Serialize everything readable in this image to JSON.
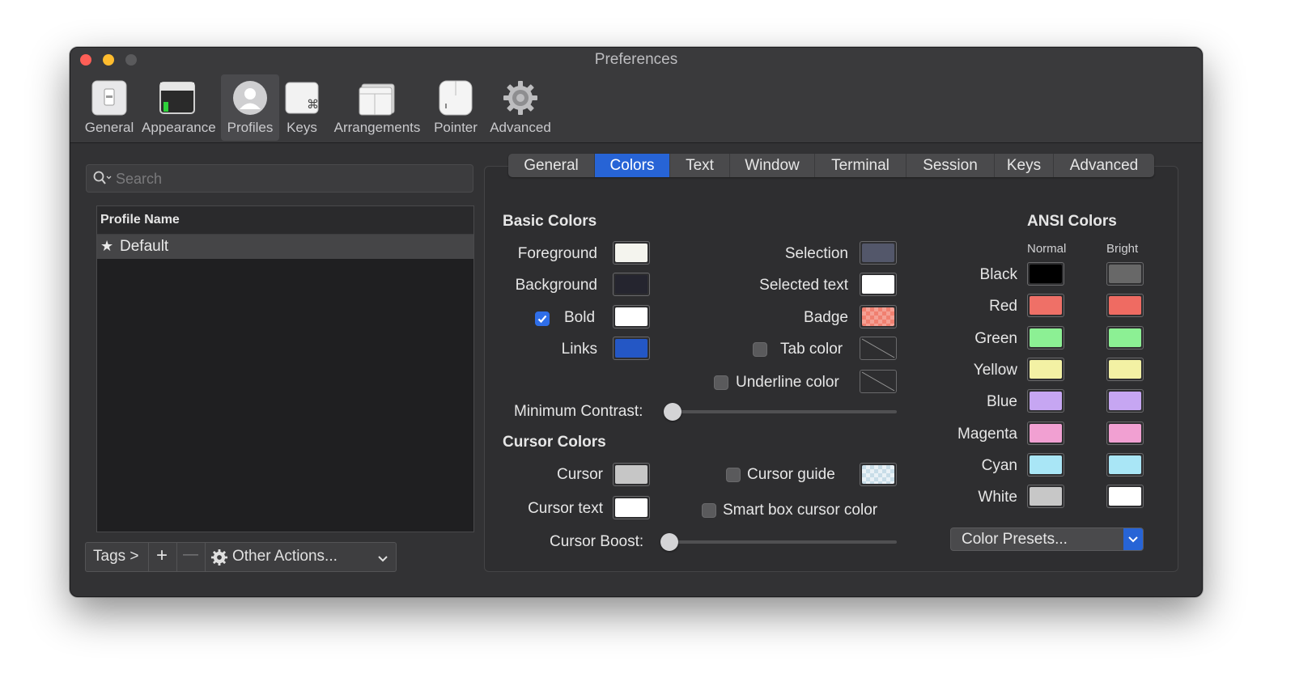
{
  "window": {
    "title": "Preferences"
  },
  "toolbar": {
    "items": [
      {
        "label": "General",
        "icon": "switch-icon"
      },
      {
        "label": "Appearance",
        "icon": "appearance-icon"
      },
      {
        "label": "Profiles",
        "icon": "profile-icon",
        "active": true
      },
      {
        "label": "Keys",
        "icon": "command-key-icon"
      },
      {
        "label": "Arrangements",
        "icon": "arrangements-icon"
      },
      {
        "label": "Pointer",
        "icon": "mouse-icon"
      },
      {
        "label": "Advanced",
        "icon": "gear-icon"
      }
    ]
  },
  "sidebar": {
    "search_placeholder": "Search",
    "profile_list": {
      "header": "Profile Name",
      "rows": [
        {
          "name": "Default",
          "default_star": "★"
        }
      ]
    },
    "bottom": {
      "tags_label": "Tags >",
      "add_label": "+",
      "remove_label": "—",
      "other_actions_label": "Other Actions..."
    }
  },
  "tabs": [
    "General",
    "Colors",
    "Text",
    "Window",
    "Terminal",
    "Session",
    "Keys",
    "Advanced"
  ],
  "active_tab": "Colors",
  "basic_colors": {
    "title": "Basic Colors",
    "foreground": {
      "label": "Foreground",
      "color": "#f4f4ee"
    },
    "background": {
      "label": "Background",
      "color": "#25252f"
    },
    "bold": {
      "label": "Bold",
      "checked": true,
      "color": "#ffffff"
    },
    "links": {
      "label": "Links",
      "color": "#2457c5"
    },
    "selection": {
      "label": "Selection",
      "color": "#53576a"
    },
    "selected_text": {
      "label": "Selected text",
      "color": "#ffffff"
    },
    "badge": {
      "label": "Badge",
      "color": "#f08070"
    },
    "tab_color": {
      "label": "Tab color",
      "checked": false
    },
    "underline_color": {
      "label": "Underline color",
      "checked": false
    },
    "minimum_contrast": {
      "label": "Minimum Contrast:",
      "value": 0
    }
  },
  "cursor_colors": {
    "title": "Cursor Colors",
    "cursor": {
      "label": "Cursor",
      "color": "#c6c6c6"
    },
    "cursor_text": {
      "label": "Cursor text",
      "color": "#ffffff"
    },
    "cursor_guide": {
      "label": "Cursor guide",
      "checked": false,
      "color": "#c8dde8"
    },
    "smart_box": {
      "label": "Smart box cursor color",
      "checked": false
    },
    "cursor_boost": {
      "label": "Cursor Boost:",
      "value": 0
    }
  },
  "ansi": {
    "title": "ANSI Colors",
    "normal_label": "Normal",
    "bright_label": "Bright",
    "rows": [
      {
        "name": "Black",
        "normal": "#000000",
        "bright": "#686868"
      },
      {
        "name": "Red",
        "normal": "#ef7067",
        "bright": "#ef6b62"
      },
      {
        "name": "Green",
        "normal": "#8cf094",
        "bright": "#8cf094"
      },
      {
        "name": "Yellow",
        "normal": "#f3f1a4",
        "bright": "#f3f1a4"
      },
      {
        "name": "Blue",
        "normal": "#c6a6f2",
        "bright": "#c6a6f2"
      },
      {
        "name": "Magenta",
        "normal": "#f1a0d2",
        "bright": "#f1a0d2"
      },
      {
        "name": "Cyan",
        "normal": "#a9e6f6",
        "bright": "#a9e6f6"
      },
      {
        "name": "White",
        "normal": "#c7c7c7",
        "bright": "#ffffff"
      }
    ]
  },
  "color_presets": {
    "label": "Color Presets..."
  }
}
